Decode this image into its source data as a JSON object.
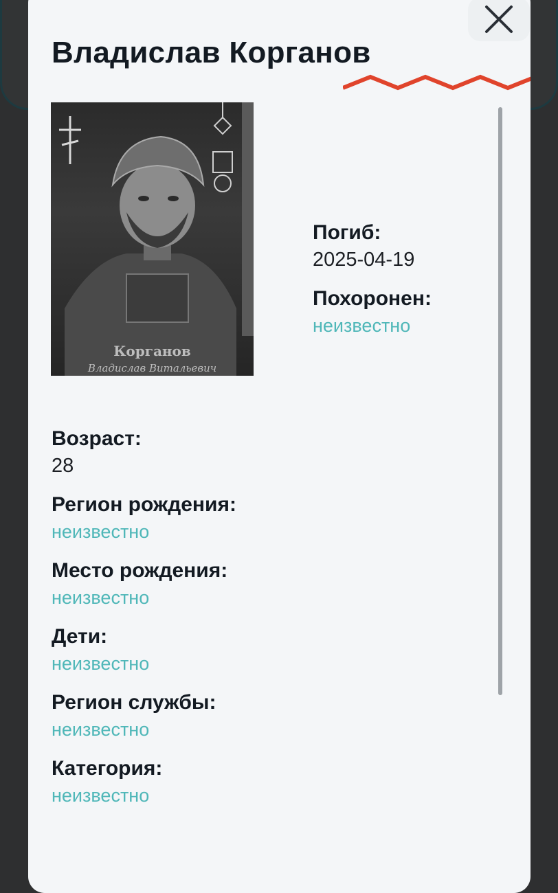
{
  "modal": {
    "title": "Владислав Корганов",
    "photo_caption": {
      "surname": "Корганов",
      "full": "Владислав Витальевич"
    },
    "side_fields": [
      {
        "label": "Погиб:",
        "value": "2025-04-19"
      },
      {
        "label": "Похоронен:",
        "value": "неизвестно"
      }
    ],
    "fields": [
      {
        "label": "Возраст:",
        "value": "28"
      },
      {
        "label": "Регион рождения:",
        "value": "неизвестно"
      },
      {
        "label": "Место рождения:",
        "value": "неизвестно"
      },
      {
        "label": "Дети:",
        "value": "неизвестно"
      },
      {
        "label": "Регион службы:",
        "value": "неизвестно"
      },
      {
        "label": "Категория:",
        "value": "неизвестно"
      }
    ]
  },
  "colors": {
    "accent": "#e0442c",
    "link": "#4fb7b8",
    "background": "#f4f6f8"
  },
  "icons": {
    "close": "close-icon"
  }
}
